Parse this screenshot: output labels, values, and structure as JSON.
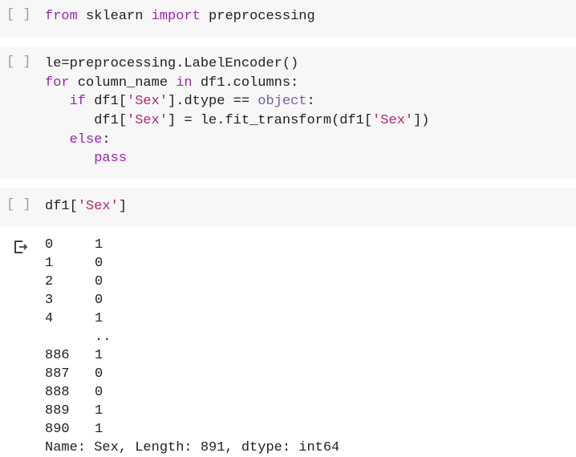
{
  "cells": [
    {
      "run_label": "[ ]",
      "lines": [
        [
          {
            "t": "from",
            "c": "kw"
          },
          {
            "t": " sklearn ",
            "c": ""
          },
          {
            "t": "import",
            "c": "kw"
          },
          {
            "t": " preprocessing",
            "c": ""
          }
        ]
      ]
    },
    {
      "run_label": "[ ]",
      "lines": [
        [
          {
            "t": "le=preprocessing.LabelEncoder()",
            "c": ""
          }
        ],
        [
          {
            "t": "for",
            "c": "kw"
          },
          {
            "t": " column_name ",
            "c": ""
          },
          {
            "t": "in",
            "c": "kw"
          },
          {
            "t": " df1.columns:",
            "c": ""
          }
        ],
        [
          {
            "t": "   ",
            "c": ""
          },
          {
            "t": "if",
            "c": "kw"
          },
          {
            "t": " df1[",
            "c": ""
          },
          {
            "t": "'Sex'",
            "c": "str"
          },
          {
            "t": "].dtype == ",
            "c": ""
          },
          {
            "t": "object",
            "c": "obj"
          },
          {
            "t": ":",
            "c": ""
          }
        ],
        [
          {
            "t": "      df1[",
            "c": ""
          },
          {
            "t": "'Sex'",
            "c": "str"
          },
          {
            "t": "] = le.fit_transform(df1[",
            "c": ""
          },
          {
            "t": "'Sex'",
            "c": "str"
          },
          {
            "t": "])",
            "c": ""
          }
        ],
        [
          {
            "t": "   ",
            "c": ""
          },
          {
            "t": "else",
            "c": "kw"
          },
          {
            "t": ":",
            "c": ""
          }
        ],
        [
          {
            "t": "      ",
            "c": ""
          },
          {
            "t": "pass",
            "c": "kw"
          }
        ]
      ]
    },
    {
      "run_label": "[ ]",
      "lines": [
        [
          {
            "t": "df1[",
            "c": ""
          },
          {
            "t": "'Sex'",
            "c": "str"
          },
          {
            "t": "]",
            "c": ""
          }
        ]
      ]
    }
  ],
  "output": {
    "icon": "output-redirect-icon",
    "rows": [
      {
        "idx": "0",
        "val": "1"
      },
      {
        "idx": "1",
        "val": "0"
      },
      {
        "idx": "2",
        "val": "0"
      },
      {
        "idx": "3",
        "val": "0"
      },
      {
        "idx": "4",
        "val": "1"
      },
      {
        "idx": "",
        "val": ".."
      },
      {
        "idx": "886",
        "val": "1"
      },
      {
        "idx": "887",
        "val": "0"
      },
      {
        "idx": "888",
        "val": "0"
      },
      {
        "idx": "889",
        "val": "1"
      },
      {
        "idx": "890",
        "val": "1"
      }
    ],
    "footer": "Name: Sex, Length: 891, dtype: int64"
  }
}
